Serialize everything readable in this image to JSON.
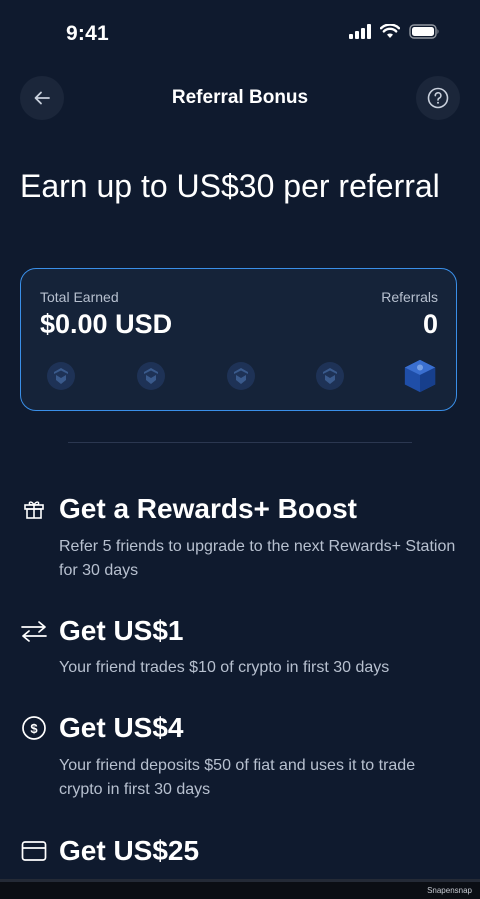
{
  "status_bar": {
    "time": "9:41"
  },
  "header": {
    "title": "Referral Bonus",
    "back_icon": "arrow-left-icon",
    "help_icon": "question-circle-icon"
  },
  "headline": "Earn up to US$30 per referral",
  "summary_card": {
    "total_earned_label": "Total Earned",
    "total_earned_value": "$0.00 USD",
    "referrals_label": "Referrals",
    "referrals_value": "0",
    "accent_color": "#3a8fe8",
    "referral_slots": [
      "crypto-token-icon",
      "crypto-token-icon",
      "crypto-token-icon",
      "crypto-token-icon",
      "reward-cube-icon"
    ]
  },
  "benefits": [
    {
      "icon": "gift-icon",
      "title": "Get a Rewards+ Boost",
      "description": "Refer 5 friends to upgrade to the next Rewards+ Station for 30 days"
    },
    {
      "icon": "exchange-arrows-icon",
      "title": "Get US$1",
      "description": "Your friend trades $10 of crypto in first 30 days"
    },
    {
      "icon": "dollar-circle-icon",
      "title": "Get US$4",
      "description": "Your friend deposits $50 of fiat and uses it to trade crypto in first 30 days"
    },
    {
      "icon": "card-icon",
      "title": "Get US$25",
      "description": ""
    }
  ],
  "watermark": "Snapensnap"
}
